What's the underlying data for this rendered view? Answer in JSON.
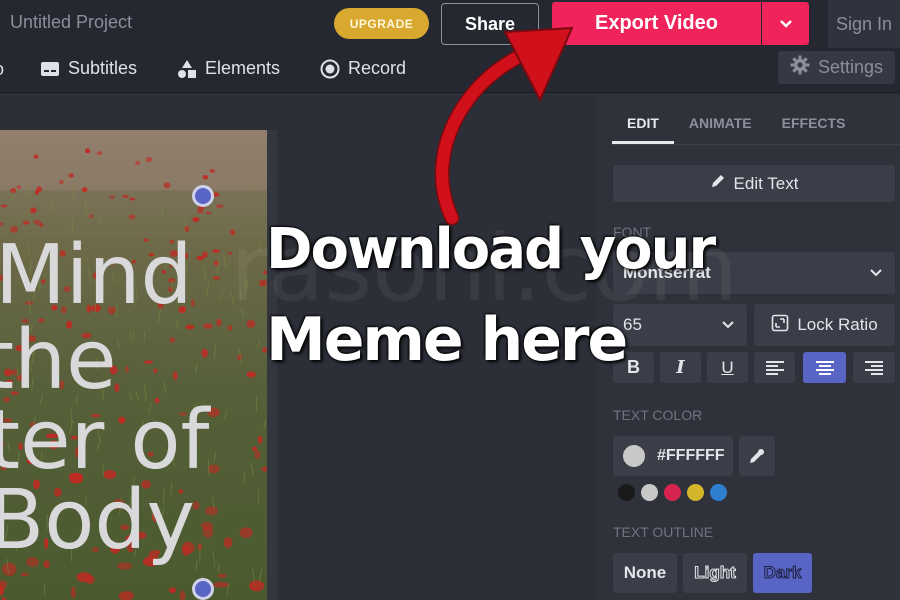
{
  "header": {
    "project_title": "Untitled Project",
    "upgrade_label": "UPGRADE",
    "share_label": "Share",
    "export_label": "Export Video",
    "sign_in_label": "Sign In"
  },
  "toolbar": {
    "items": [
      {
        "label": "Subtitles",
        "icon": "subtitles-icon"
      },
      {
        "label": "Elements",
        "icon": "elements-icon"
      },
      {
        "label": "Record",
        "icon": "record-icon"
      }
    ],
    "settings_label": "Settings"
  },
  "canvas": {
    "text_lines": [
      "Mind",
      "the",
      "ter of",
      "Body"
    ]
  },
  "annotation": {
    "line1": "Download your",
    "line2": "Meme here",
    "arrow_color": "#d0101a"
  },
  "panel": {
    "tabs": [
      "EDIT",
      "ANIMATE",
      "EFFECTS"
    ],
    "active_tab": "EDIT",
    "edit_text_label": "Edit Text",
    "font_section_label": "FONT",
    "font_value": "Montserrat",
    "font_size_value": "65",
    "lock_ratio_label": "Lock Ratio",
    "format_buttons": [
      "B",
      "I",
      "U",
      "align-left",
      "align-center",
      "align-right"
    ],
    "active_format": "align-center",
    "text_color_label": "TEXT COLOR",
    "text_color_hex": "#FFFFFF",
    "color_swatches": [
      "#1a1a1a",
      "#c8c8c8",
      "#d6244f",
      "#d4b62a",
      "#2f7fd0"
    ],
    "text_outline_label": "TEXT OUTLINE",
    "outline_options": [
      "None",
      "Light",
      "Dark"
    ],
    "active_outline": "Dark"
  },
  "colors": {
    "accent": "#f0245b",
    "upgrade": "#d9a82e",
    "selected": "#5965c4"
  }
}
